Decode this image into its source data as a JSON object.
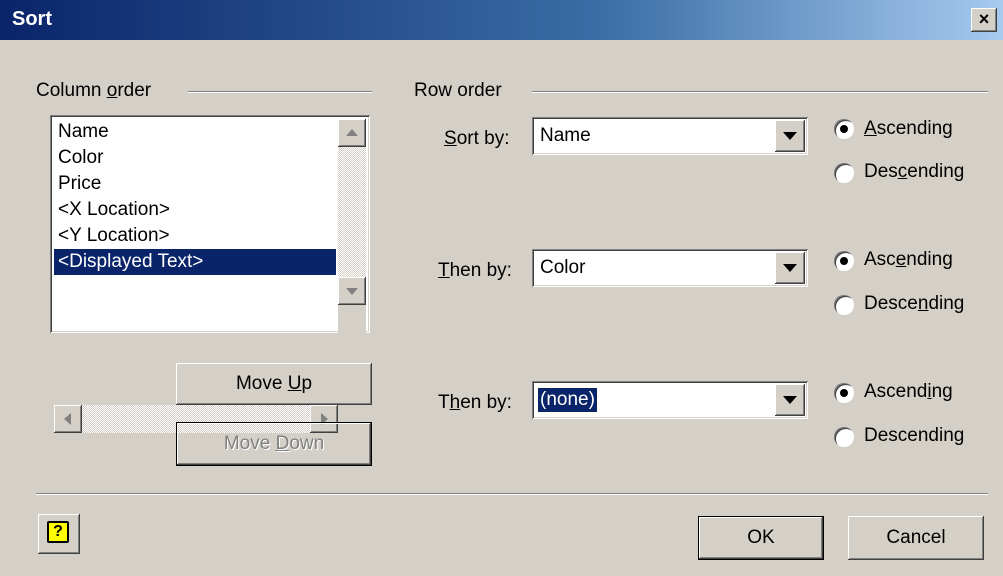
{
  "window": {
    "title": "Sort",
    "close_glyph": "×"
  },
  "column_order": {
    "label_pre": "Column ",
    "label_key": "o",
    "label_post": "rder",
    "items": [
      "Name",
      "Color",
      "Price",
      "<X Location>",
      "<Y Location>",
      "<Displayed Text>"
    ],
    "selected_index": 5
  },
  "buttons": {
    "move_up": {
      "pre": "Move ",
      "key": "U",
      "post": "p"
    },
    "move_down": {
      "pre": "Move ",
      "key": "D",
      "post": "own"
    },
    "ok": "OK",
    "cancel": "Cancel",
    "help_glyph": "?"
  },
  "row_order": {
    "label": "Row order",
    "rows": [
      {
        "label_pre": "",
        "label_key": "S",
        "label_post": "ort by:",
        "value": "Name",
        "asc": {
          "pre": "",
          "key": "A",
          "post": "scending"
        },
        "desc": {
          "pre": "Des",
          "key": "c",
          "post": "ending"
        },
        "selected": "ascending"
      },
      {
        "label_pre": "",
        "label_key": "T",
        "label_post": "hen by:",
        "value": "Color",
        "asc": {
          "pre": "Asc",
          "key": "e",
          "post": "nding"
        },
        "desc": {
          "pre": "Desce",
          "key": "n",
          "post": "ding"
        },
        "selected": "ascending"
      },
      {
        "label_pre": "T",
        "label_key": "h",
        "label_post": "en by:",
        "value": "(none)",
        "asc": {
          "pre": "Ascend",
          "key": "i",
          "post": "ng"
        },
        "desc": {
          "pre": "Descendin",
          "key": "g",
          "post": ""
        },
        "selected": "ascending"
      }
    ]
  },
  "icons": [
    "close-icon",
    "scroll-up-arrow-icon",
    "scroll-down-arrow-icon",
    "scroll-left-arrow-icon",
    "scroll-right-arrow-icon",
    "dropdown-arrow-icon",
    "help-icon"
  ],
  "colors": {
    "title_start": "#0a246a",
    "title_end": "#a6caf0",
    "face": "#d4d0c8",
    "selection": "#0a246a"
  }
}
